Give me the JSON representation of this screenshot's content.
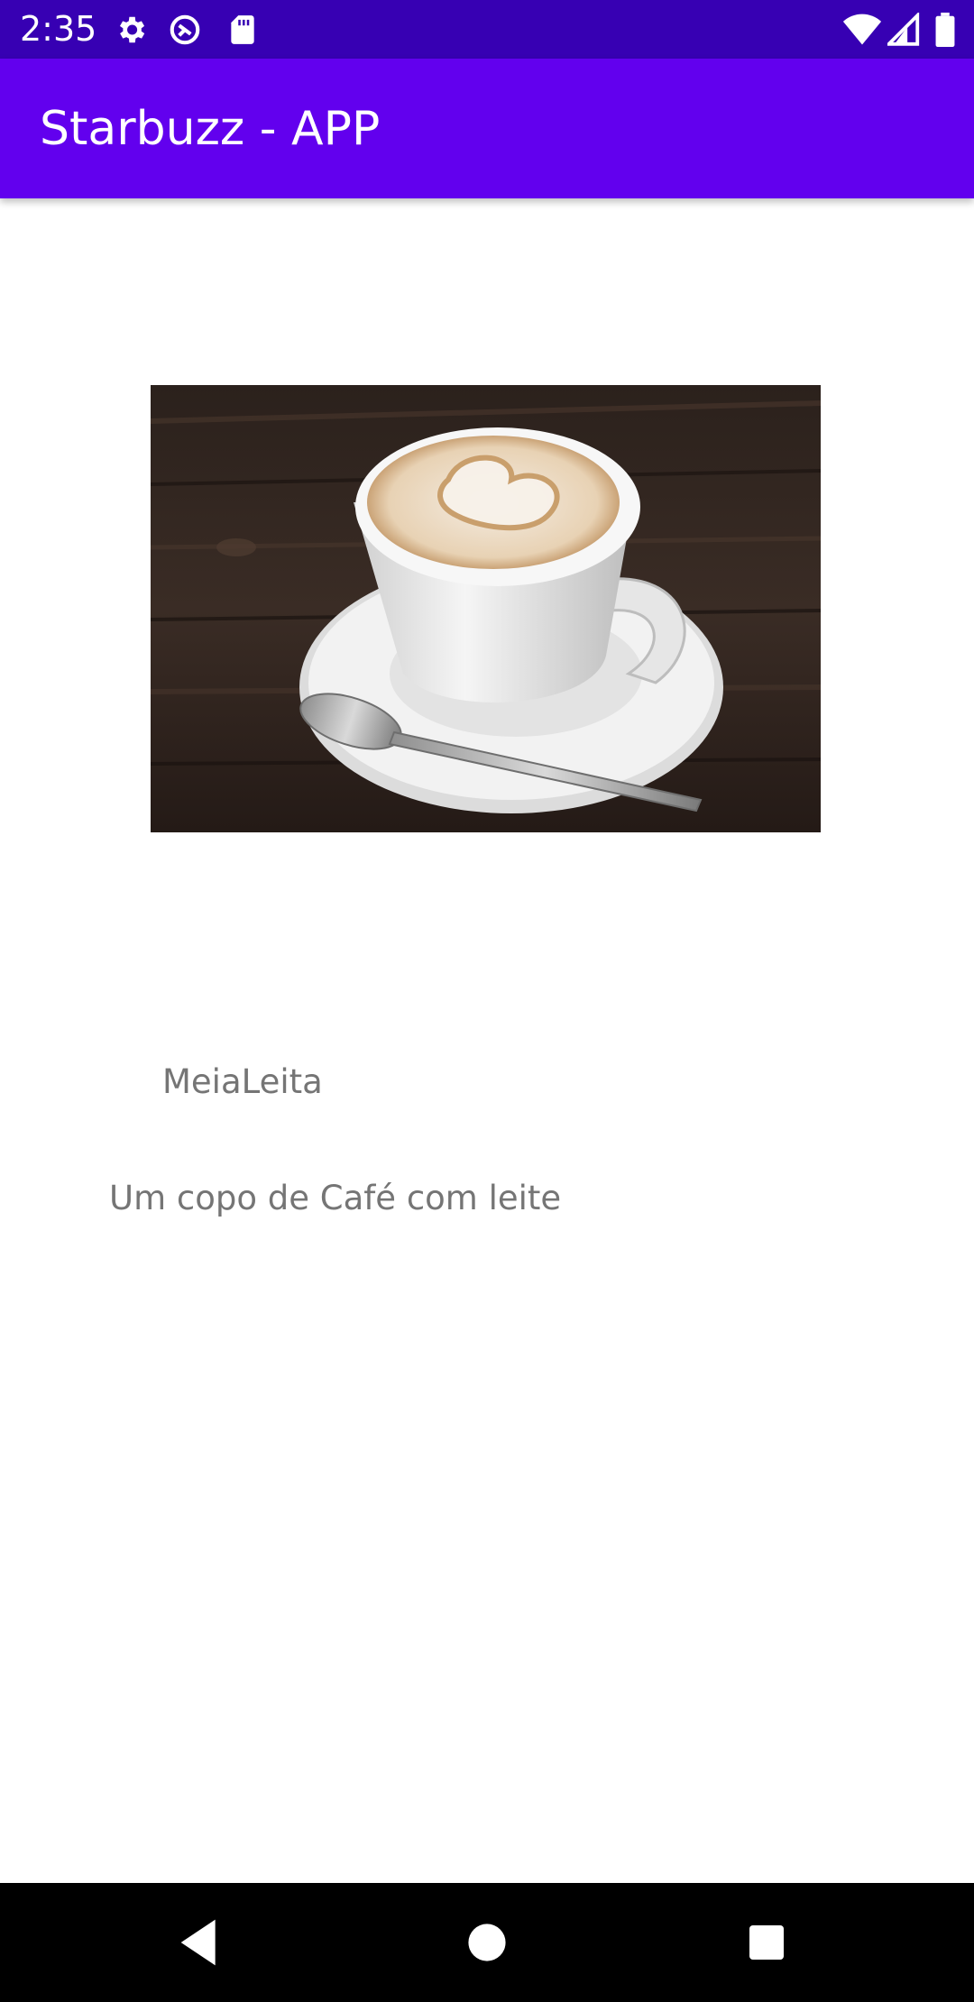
{
  "status_bar": {
    "time": "2:35",
    "left_icons": [
      "settings-icon",
      "sync-icon",
      "sd-card-icon"
    ],
    "right_icons": [
      "wifi-icon",
      "signal-icon",
      "battery-icon"
    ],
    "background": "#3700b3"
  },
  "app_bar": {
    "title": "Starbuzz - APP",
    "background": "#6200ee"
  },
  "content": {
    "image": "coffee-cup-photo",
    "name": "MeiaLeita",
    "description": "Um copo de Café com leite",
    "text_color": "#757575"
  },
  "nav_bar": {
    "buttons": [
      "back-icon",
      "home-icon",
      "recents-icon"
    ]
  }
}
